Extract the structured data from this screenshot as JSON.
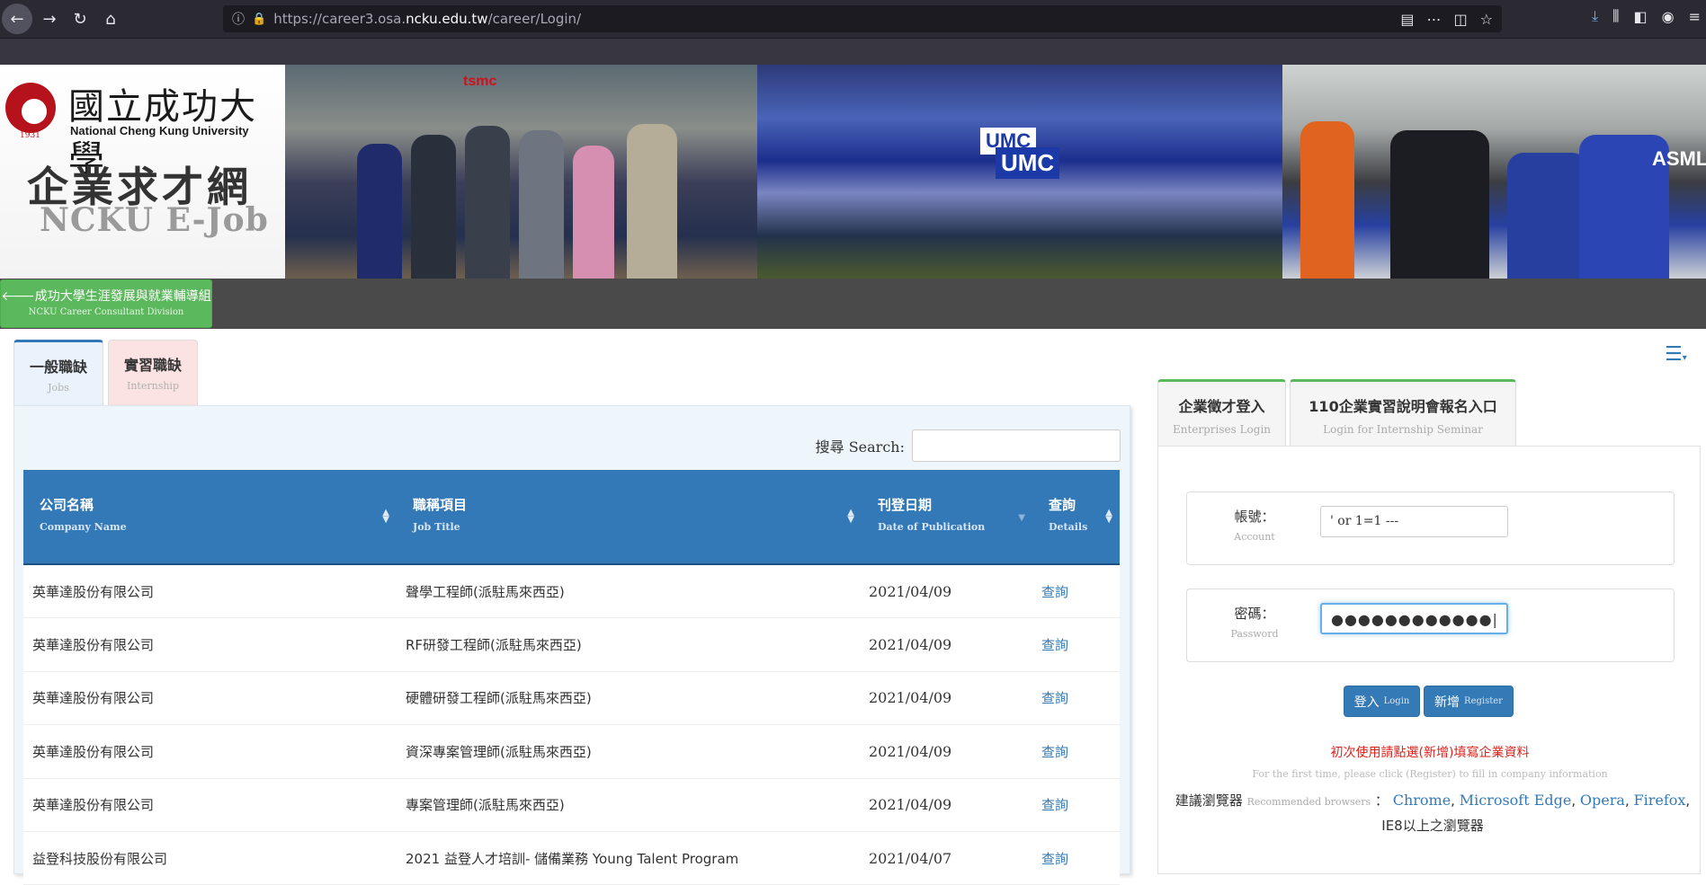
{
  "browser": {
    "url_prefix": "https://career3.osa.",
    "url_domain": "ncku.edu.tw",
    "url_path": "/career/Login/"
  },
  "header": {
    "university_cn": "國立成功大學",
    "university_en": "National Cheng Kung University",
    "seal_year": "1931",
    "site_cn": "企業求才網",
    "site_en": "NCKU E-Job",
    "banner_badges": [
      "tsmc",
      "UMC",
      "UMC",
      "ASML"
    ]
  },
  "division_button": {
    "label_cn": "🡐成功大學生涯發展與就業輔導組",
    "label_en": "NCKU Career Consultant Division"
  },
  "tabs": [
    {
      "cn": "一般職缺",
      "en": "Jobs"
    },
    {
      "cn": "實習職缺",
      "en": "Internship"
    }
  ],
  "search": {
    "label": "搜尋 Search:",
    "value": ""
  },
  "table": {
    "columns": [
      {
        "cn": "公司名稱",
        "en": "Company Name"
      },
      {
        "cn": "職稱項目",
        "en": "Job Title"
      },
      {
        "cn": "刊登日期",
        "en": "Date of Publication"
      },
      {
        "cn": "查詢",
        "en": "Details"
      }
    ],
    "rows": [
      {
        "company": "英華達股份有限公司",
        "title": "聲學工程師(派駐馬來西亞)",
        "date": "2021/04/09",
        "detail": "查詢"
      },
      {
        "company": "英華達股份有限公司",
        "title": "RF研發工程師(派駐馬來西亞)",
        "date": "2021/04/09",
        "detail": "查詢"
      },
      {
        "company": "英華達股份有限公司",
        "title": "硬體研發工程師(派駐馬來西亞)",
        "date": "2021/04/09",
        "detail": "查詢"
      },
      {
        "company": "英華達股份有限公司",
        "title": "資深專案管理師(派駐馬來西亞)",
        "date": "2021/04/09",
        "detail": "查詢"
      },
      {
        "company": "英華達股份有限公司",
        "title": "專案管理師(派駐馬來西亞)",
        "date": "2021/04/09",
        "detail": "查詢"
      },
      {
        "company": "益登科技股份有限公司",
        "title": "2021 益登人才培訓- 儲備業務 Young Talent Program",
        "date": "2021/04/07",
        "detail": "查詢"
      }
    ]
  },
  "login_tabs": [
    {
      "cn": "企業徵才登入",
      "en": "Enterprises Login"
    },
    {
      "cn": "110企業實習說明會報名入口",
      "en": "Login for Internship Seminar"
    }
  ],
  "login": {
    "account_label_cn": "帳號：",
    "account_label_en": "Account",
    "account_value": "' or 1=1 ---",
    "password_label_cn": "密碼：",
    "password_label_en": "Password",
    "password_value": "●●●●●●●●●●●●|",
    "login_btn": "登入",
    "login_btn_en": "Login",
    "register_btn": "新增",
    "register_btn_en": "Register",
    "notice_cn": "初次使用請點選(新增)填寫企業資料",
    "notice_en": "For the first time, please click (Register) to fill in company information",
    "browsers_cn": "建議瀏覽器",
    "browsers_en": "Recommended browsers",
    "browsers_sep": "：",
    "browser_links": [
      "Chrome",
      "Microsoft Edge",
      "Opera",
      "Firefox"
    ],
    "browsers_tail": ", IE8以上之瀏覽器"
  },
  "colors": {
    "primary": "#3379b7",
    "success": "#5cb85c",
    "danger": "#e0201b"
  }
}
